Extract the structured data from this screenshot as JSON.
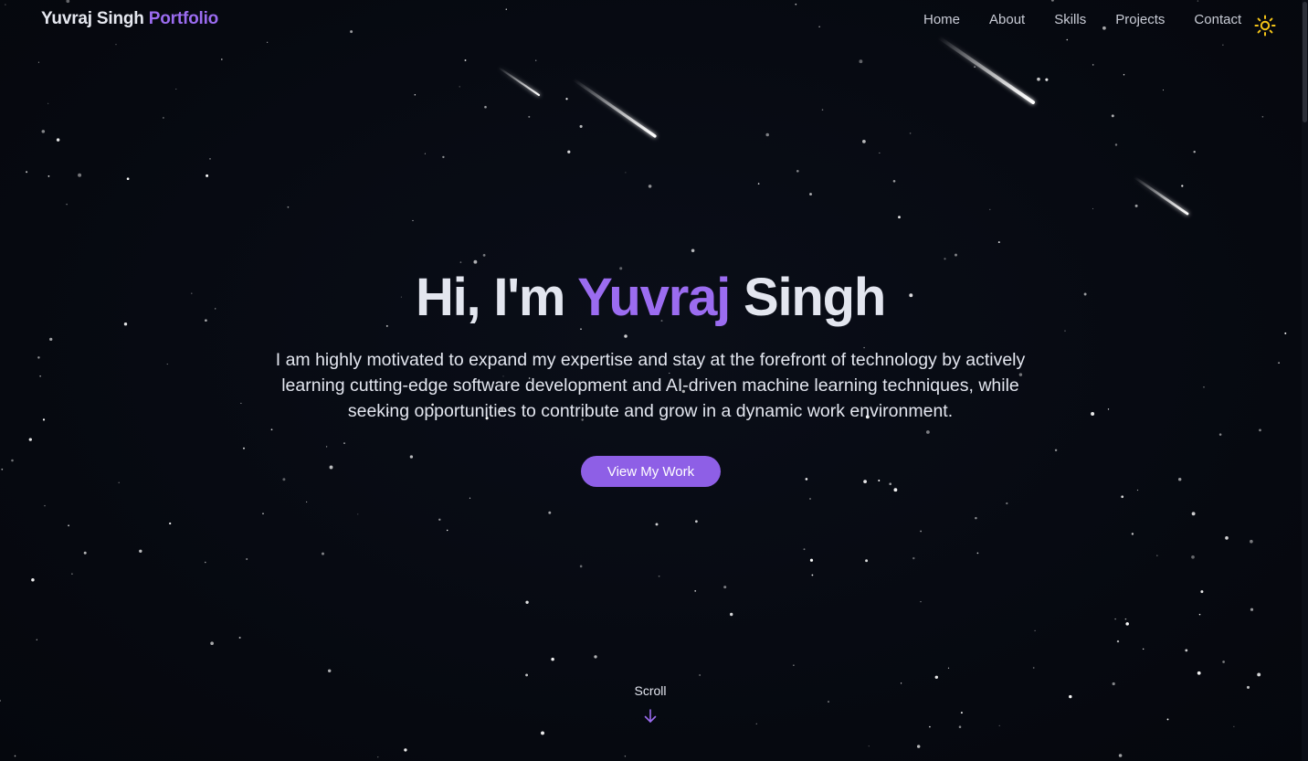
{
  "brand": {
    "name": "Yuvraj Singh",
    "accent": "Portfolio"
  },
  "nav": {
    "items": [
      {
        "label": "Home"
      },
      {
        "label": "About"
      },
      {
        "label": "Skills"
      },
      {
        "label": "Projects"
      },
      {
        "label": "Contact"
      }
    ],
    "theme_icon": "sun-icon"
  },
  "hero": {
    "greeting": "Hi, I'm",
    "first_name": "Yuvraj",
    "last_name": "Singh",
    "description": "I am highly motivated to expand my expertise and stay at the forefront of technology by actively learning cutting-edge software development and AI-driven machine learning techniques, while seeking opportunities to contribute and grow in a dynamic work environment.",
    "cta_label": "View My Work"
  },
  "scroll": {
    "label": "Scroll",
    "icon": "arrow-down-icon"
  },
  "colors": {
    "background": "#070a12",
    "accent": "#9b6cf0",
    "button": "#8e5fe6",
    "text": "#e3e6ef",
    "sun": "#f5c518"
  }
}
